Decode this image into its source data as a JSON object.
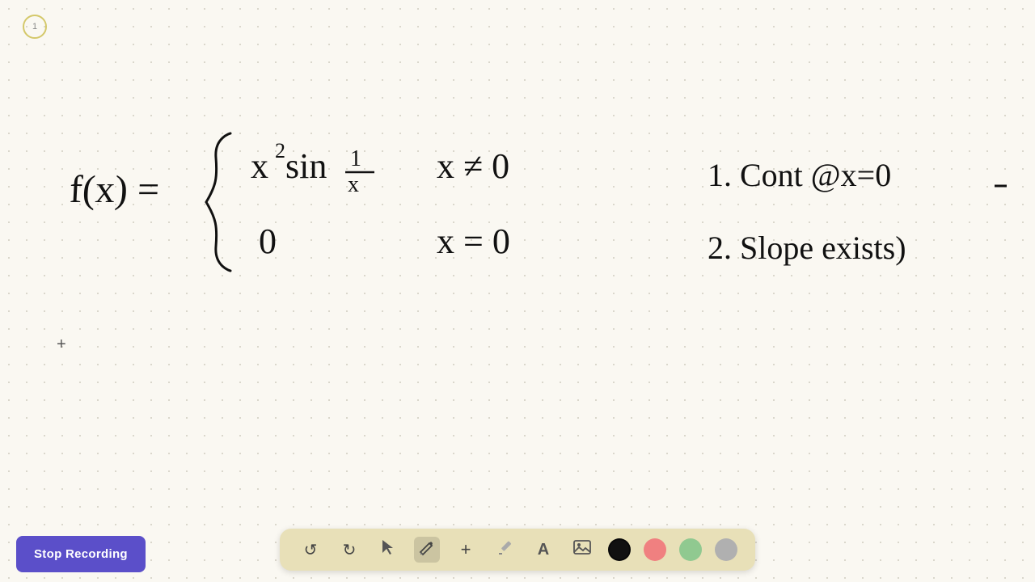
{
  "toolbar": {
    "stop_recording_label": "Stop Recording",
    "undo_label": "↺",
    "redo_label": "↻",
    "select_label": "▲",
    "pen_label": "✏",
    "add_label": "+",
    "highlighter_label": "/",
    "text_label": "A",
    "image_label": "🖼",
    "colors": [
      "#111111",
      "#f08080",
      "#90c990",
      "#b0b0b0"
    ]
  },
  "timer": {
    "value": "1"
  },
  "canvas": {
    "crosshair_label": "+"
  }
}
